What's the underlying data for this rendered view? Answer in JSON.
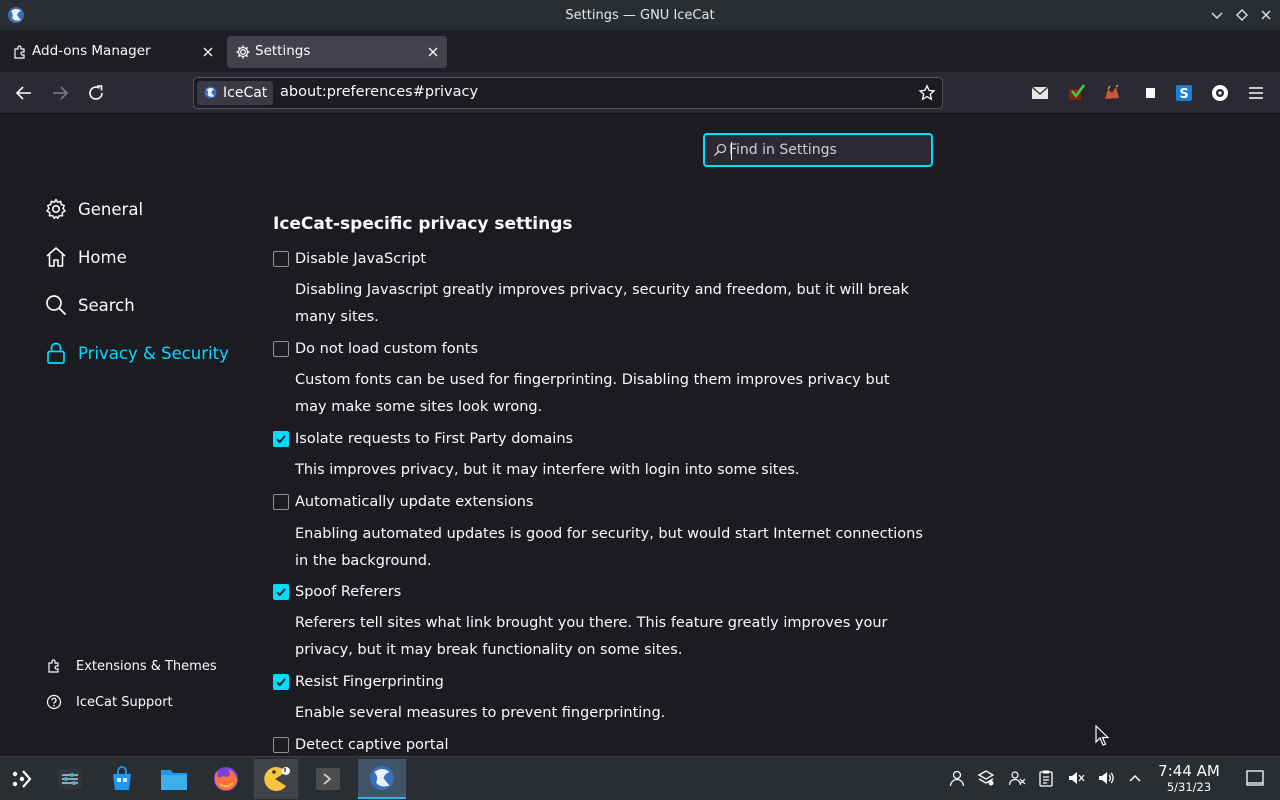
{
  "window": {
    "title": "Settings — GNU IceCat"
  },
  "tabs": [
    {
      "label": "Add-ons Manager",
      "active": false
    },
    {
      "label": "Settings",
      "active": true
    }
  ],
  "navbar": {
    "identity_label": "IceCat",
    "url": "about:preferences#privacy"
  },
  "search": {
    "placeholder": "Find in Settings"
  },
  "sidebar": {
    "items": [
      {
        "label": "General",
        "icon": "gear-icon",
        "active": false
      },
      {
        "label": "Home",
        "icon": "home-icon",
        "active": false
      },
      {
        "label": "Search",
        "icon": "search-icon",
        "active": false
      },
      {
        "label": "Privacy & Security",
        "icon": "lock-icon",
        "active": true
      }
    ],
    "footer": [
      {
        "label": "Extensions & Themes",
        "icon": "puzzle-icon"
      },
      {
        "label": "IceCat Support",
        "icon": "help-icon"
      }
    ]
  },
  "main": {
    "section_title": "IceCat-specific privacy settings",
    "options": [
      {
        "label": "Disable JavaScript",
        "checked": false,
        "description": "Disabling Javascript greatly improves privacy, security and freedom, but it will break many sites."
      },
      {
        "label": "Do not load custom fonts",
        "checked": false,
        "description": "Custom fonts can be used for fingerprinting. Disabling them improves privacy but may make some sites look wrong."
      },
      {
        "label": "Isolate requests to First Party domains",
        "checked": true,
        "description": "This improves privacy, but it may interfere with login into some sites."
      },
      {
        "label": "Automatically update extensions",
        "checked": false,
        "description": "Enabling automated updates is good for security, but would start Internet connections in the background."
      },
      {
        "label": "Spoof Referers",
        "checked": true,
        "description": "Referers tell sites what link brought you there. This feature greatly improves your privacy, but it may break functionality on some sites."
      },
      {
        "label": "Resist Fingerprinting",
        "checked": true,
        "description": "Enable several measures to prevent fingerprinting."
      },
      {
        "label": "Detect captive portal",
        "checked": false,
        "description": ""
      }
    ]
  },
  "taskbar": {
    "time": "7:44 AM",
    "date": "5/31/23"
  },
  "colors": {
    "accent": "#00ddff",
    "background": "#1c1b22",
    "toolbar": "#2b2a33"
  }
}
